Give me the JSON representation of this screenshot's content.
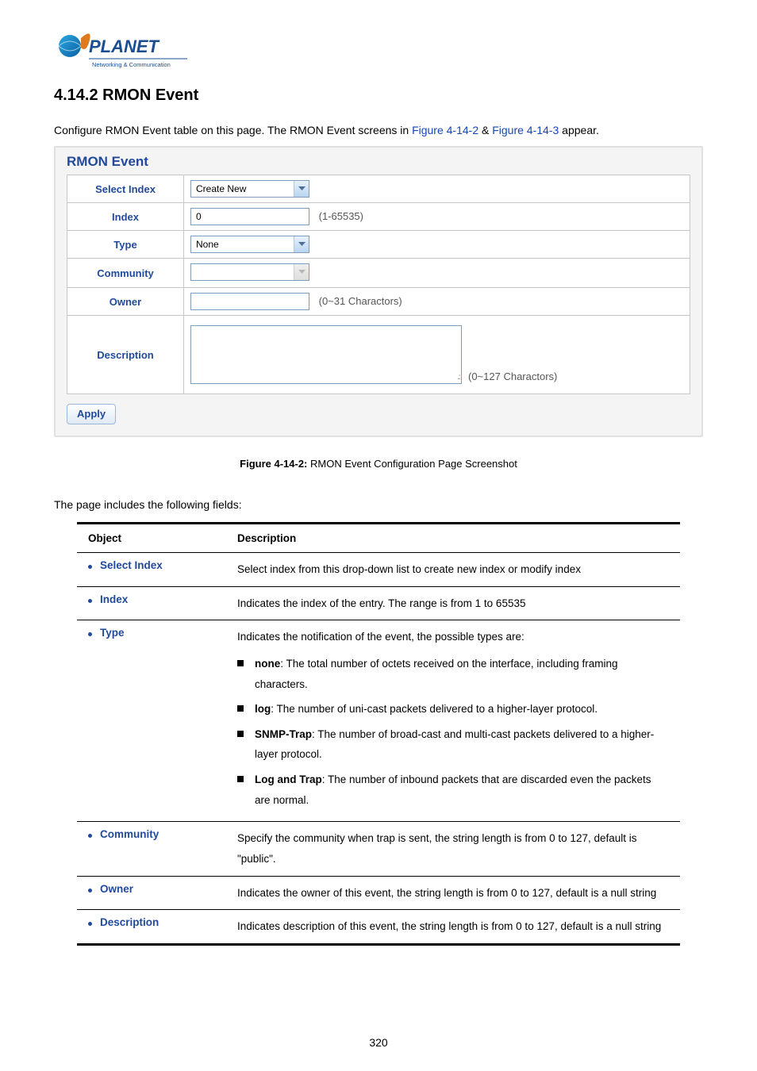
{
  "logo": {
    "brand": "PLANET",
    "tagline": "Networking & Communication"
  },
  "heading": "4.14.2 RMON Event",
  "intro": {
    "pre": "Configure RMON Event table on this page. The RMON Event screens in ",
    "link1": "Figure 4-14-2",
    "mid": " & ",
    "link2": "Figure 4-14-3",
    "post": " appear."
  },
  "panel": {
    "title": "RMON Event",
    "rows": {
      "select_index": {
        "label": "Select Index",
        "value": "Create New"
      },
      "index": {
        "label": "Index",
        "value": "0",
        "note": "(1-65535)"
      },
      "type": {
        "label": "Type",
        "value": "None"
      },
      "community": {
        "label": "Community",
        "value": ""
      },
      "owner": {
        "label": "Owner",
        "value": "",
        "note": "(0~31 Charactors)"
      },
      "description": {
        "label": "Description",
        "value": "",
        "note": "(0~127 Charactors)"
      }
    },
    "apply": "Apply"
  },
  "caption": {
    "bold": "Figure 4-14-2:",
    "rest": " RMON Event Configuration Page Screenshot"
  },
  "fields_intro": "The page includes the following fields:",
  "table": {
    "headers": {
      "object": "Object",
      "description": "Description"
    },
    "rows": {
      "select_index": {
        "object": "Select Index",
        "description": "Select index from this drop-down list to create new index or modify index"
      },
      "index": {
        "object": "Index",
        "description": "Indicates the index of the entry. The range is from 1 to 65535"
      },
      "type": {
        "object": "Type",
        "intro": "Indicates the notification of the event, the possible types are:",
        "items": {
          "none": {
            "label": "none",
            "text": ": The total number of octets received on the interface, including framing characters."
          },
          "log": {
            "label": "log",
            "text": ": The number of uni-cast packets delivered to a higher-layer protocol."
          },
          "snmp_trap": {
            "label": "SNMP-Trap",
            "text": ": The number of broad-cast and multi-cast packets delivered to a higher-layer protocol."
          },
          "log_and_trap": {
            "label": "Log and Trap",
            "text": ": The number of inbound packets that are discarded even the packets are normal."
          }
        }
      },
      "community": {
        "object": "Community",
        "description": "Specify the community when trap is sent, the string length is from 0 to 127, default is \"public\"."
      },
      "owner": {
        "object": "Owner",
        "description": "Indicates the owner of this event, the string length is from 0 to 127, default is a null string"
      },
      "description": {
        "object": "Description",
        "description": "Indicates description of this event, the string length is from 0 to 127, default is a null string"
      }
    }
  },
  "page_number": "320"
}
